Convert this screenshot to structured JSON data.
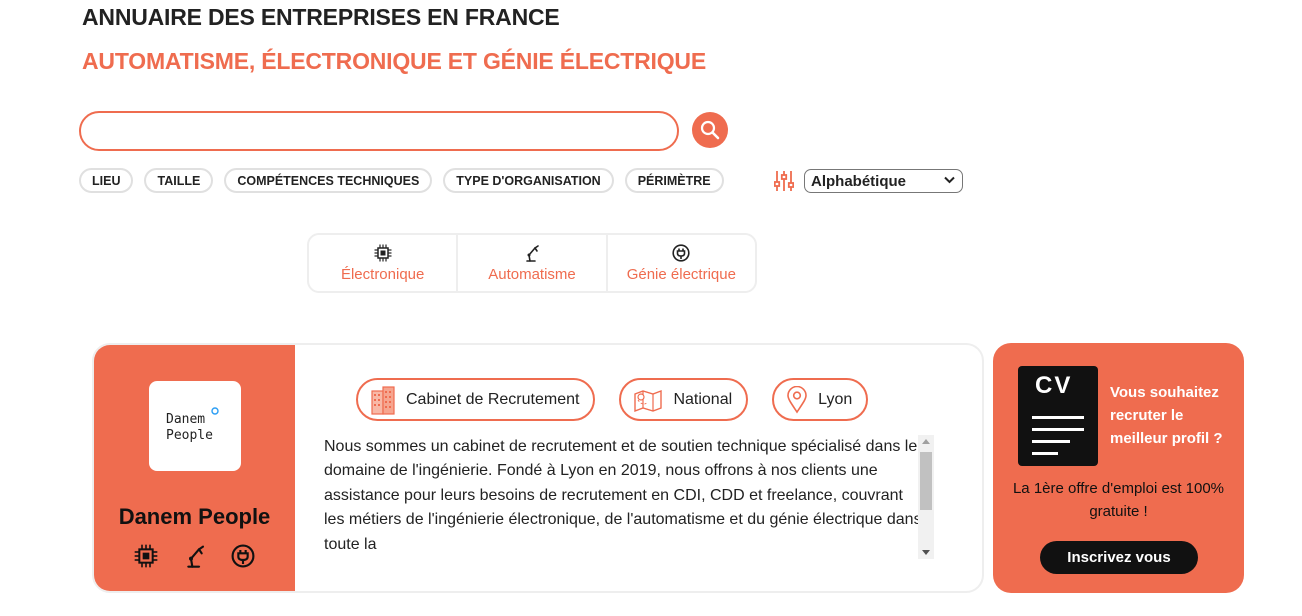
{
  "header": {
    "title": "ANNUAIRE DES ENTREPRISES EN FRANCE",
    "subtitle": "AUTOMATISME, ÉLECTRONIQUE ET GÉNIE ÉLECTRIQUE"
  },
  "search": {
    "value": "",
    "placeholder": ""
  },
  "filters": [
    "LIEU",
    "TAILLE",
    "COMPÉTENCES TECHNIQUES",
    "TYPE D'ORGANISATION",
    "PÉRIMÈTRE"
  ],
  "sort": {
    "selected": "Alphabétique"
  },
  "categories": [
    {
      "label": "Électronique",
      "icon": "chip-icon"
    },
    {
      "label": "Automatisme",
      "icon": "robot-arm-icon"
    },
    {
      "label": "Génie électrique",
      "icon": "plug-icon"
    }
  ],
  "company": {
    "name": "Danem People",
    "logo_text_line1": "Danem",
    "logo_text_line2": "People",
    "tags": [
      {
        "label": "Cabinet de Recrutement",
        "icon": "building-icon"
      },
      {
        "label": "National",
        "icon": "map-icon"
      },
      {
        "label": "Lyon",
        "icon": "location-pin-icon"
      }
    ],
    "description": "Nous sommes un cabinet de recrutement et de soutien technique spécialisé dans le domaine de l'ingénierie. Fondé à Lyon en 2019, nous offrons à nos clients une assistance pour leurs besoins de recrutement en CDI, CDD et freelance, couvrant les métiers de l'ingénierie électronique, de l'automatisme et du génie électrique dans toute la"
  },
  "promo": {
    "cv_label": "CV",
    "title": "Vous souhaitez recruter le meilleur profil ?",
    "subtitle": "La 1ère offre d'emploi est 100% gratuite !",
    "button": "Inscrivez vous"
  },
  "colors": {
    "accent": "#ef6c4f",
    "dark": "#111111",
    "border": "#eeeeee"
  }
}
